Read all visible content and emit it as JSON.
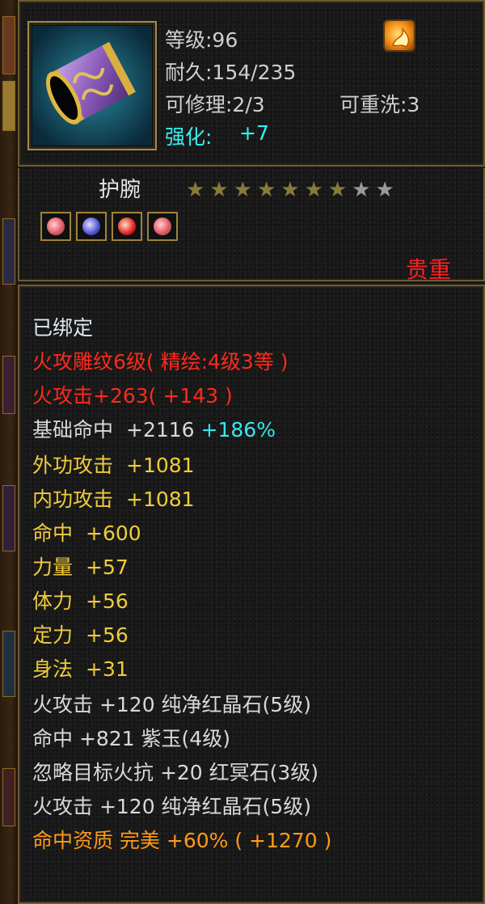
{
  "header": {
    "level": "等级:96",
    "durability": "耐久:154/235",
    "repairable": "可修理:2/3",
    "rewashable": "可重洗:3",
    "enhance_label": "强化:",
    "enhance_value": "+7"
  },
  "item": {
    "name": "护腕",
    "stars_filled": 7,
    "stars_total": 9,
    "rarity": "贵重",
    "gems": [
      "green-gem",
      "blue-gem",
      "red-gem",
      "green-gem"
    ]
  },
  "attributes": {
    "bound": "已绑定",
    "engrave": "火攻雕纹6级( 精绘:4级3等 )",
    "fire_attack_main": "火攻击+263( +143 )",
    "base_hit_label": "基础命中",
    "base_hit_value": "+2116",
    "base_hit_pct": "+186%",
    "lines": [
      {
        "label": "外功攻击",
        "value": "+1081"
      },
      {
        "label": "内功攻击",
        "value": "+1081"
      },
      {
        "label": "命中",
        "value": "+600"
      },
      {
        "label": "力量",
        "value": "+57"
      },
      {
        "label": "体力",
        "value": "+56"
      },
      {
        "label": "定力",
        "value": "+56"
      },
      {
        "label": "身法",
        "value": "+31"
      }
    ],
    "gem_lines": [
      {
        "text": "火攻击 +120 纯净红晶石(5级)"
      },
      {
        "text": "命中 +821 紫玉(4级)"
      },
      {
        "text": "忽略目标火抗 +20 红冥石(3级)"
      },
      {
        "text": "火攻击 +120 纯净红晶石(5级)"
      }
    ],
    "quality": "命中资质  完美 +60% ( +1270 )"
  },
  "colors": {
    "enhance": "#35f0f0",
    "rarity": "#ff2020",
    "red_attr": "#ff2a1a",
    "gold_attr": "#f0cc3a",
    "quality": "#ff9a1a"
  }
}
